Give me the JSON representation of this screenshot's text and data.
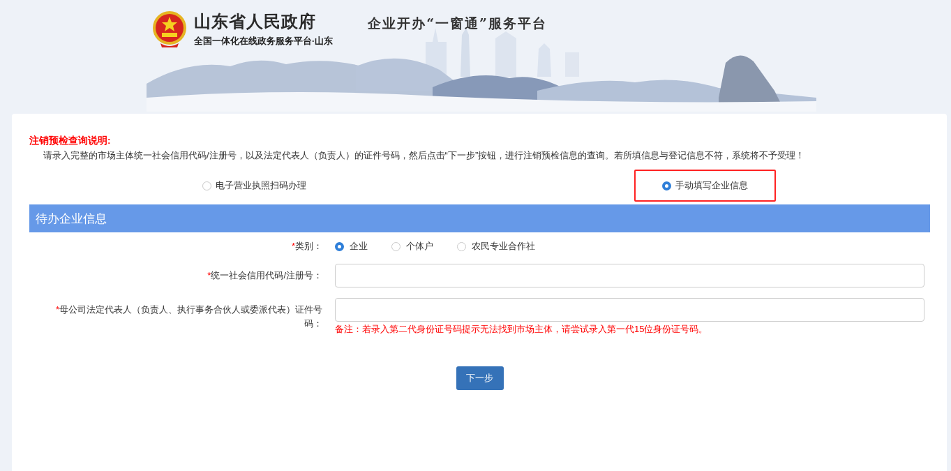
{
  "header": {
    "site_name": "山东省人民政府",
    "site_subtitle": "全国一体化在线政务服务平台·山东",
    "platform_title": "企业开办“一窗通”服务平台"
  },
  "notice": {
    "title": "注销预检查询说明:",
    "body": "请录入完整的市场主体统一社会信用代码/注册号，以及法定代表人（负责人）的证件号码，然后点击“下一步”按钮，进行注销预检信息的查询。若所填信息与登记信息不符，系统将不予受理！"
  },
  "modes": [
    {
      "label": "电子营业执照扫码办理",
      "selected": false,
      "highlighted": false
    },
    {
      "label": "手动填写企业信息",
      "selected": true,
      "highlighted": true
    }
  ],
  "section": {
    "title": "待办企业信息"
  },
  "fields": [
    {
      "kind": "radio",
      "required_mark": "*",
      "label": "类别：",
      "options": [
        {
          "label": "企业",
          "selected": true
        },
        {
          "label": "个体户",
          "selected": false
        },
        {
          "label": "农民专业合作社",
          "selected": false
        }
      ]
    },
    {
      "kind": "text",
      "required_mark": "*",
      "label": "统一社会信用代码/注册号："
    },
    {
      "kind": "text",
      "required_mark": "*",
      "label": "母公司法定代表人（负责人、执行事务合伙人或委派代表）证件号码：",
      "note": "备注：若录入第二代身份证号码提示无法找到市场主体，请尝试录入第一代15位身份证号码。"
    }
  ],
  "next_button": "下一步"
}
